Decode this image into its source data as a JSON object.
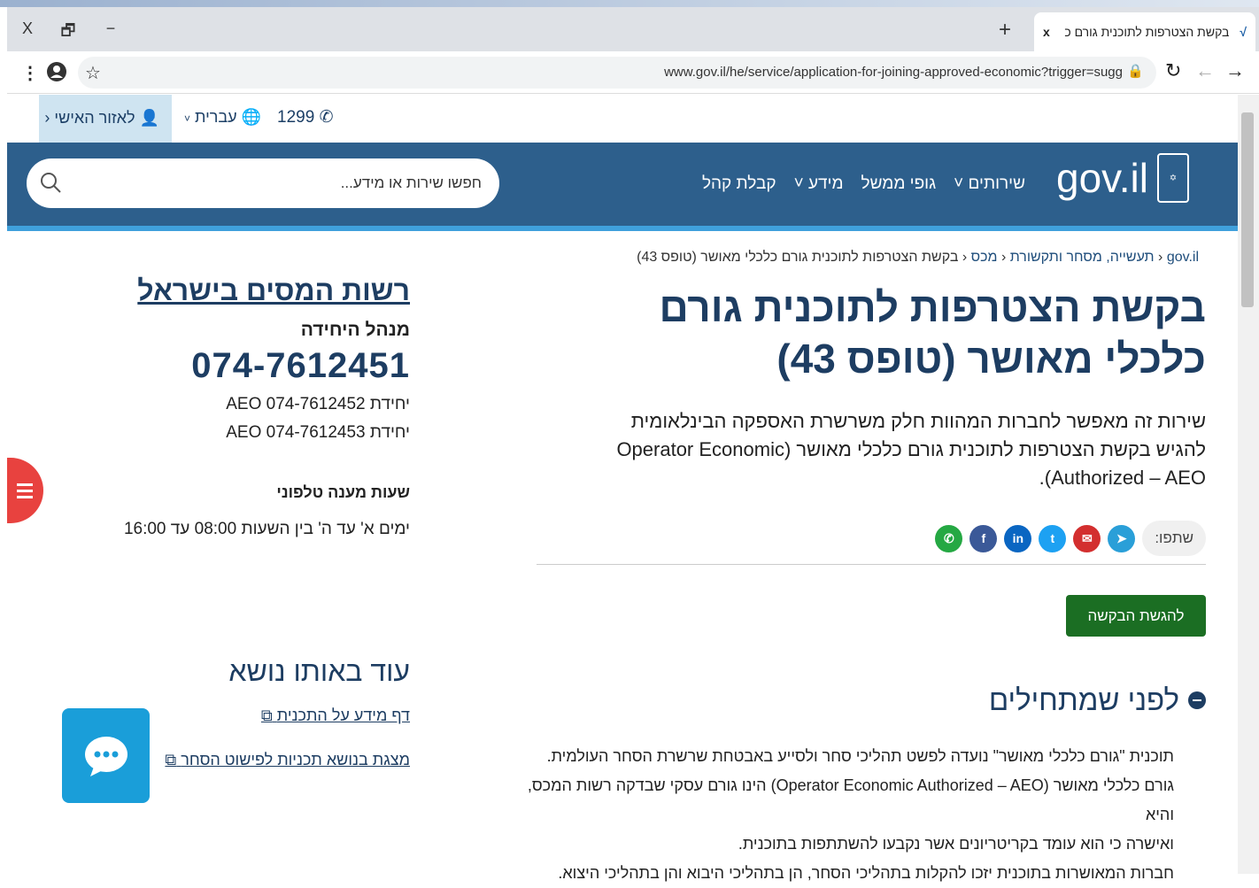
{
  "browser": {
    "tab_title": "בקשת הצטרפות לתוכנית גורם כ",
    "tab_close": "x",
    "url": "www.gov.il/he/service/application-for-joining-approved-economic?trigger=sugg",
    "close_label": "X",
    "restore_label": "🗗",
    "minimize_label": "−",
    "new_tab_label": "+"
  },
  "utility": {
    "personal_area": "לאזור האישי",
    "language": "עברית",
    "phone": "1299"
  },
  "header": {
    "logo_text": "gov.il",
    "nav": [
      "שירותים",
      "גופי ממשל",
      "מידע",
      "קבלת קהל"
    ],
    "search_placeholder": "חפשו שירות או מידע..."
  },
  "breadcrumb": [
    "gov.il",
    "תעשייה, מסחר ותקשורת",
    "מכס",
    "בקשת הצטרפות לתוכנית גורם כלכלי מאושר (טופס 43)"
  ],
  "page": {
    "title": "בקשת הצטרפות לתוכנית גורם כלכלי מאושר (טופס 43)",
    "description": "שירות זה מאפשר לחברות המהוות חלק משרשרת האספקה הבינלאומית להגיש בקשת הצטרפות לתוכנית גורם כלכלי מאושר (Operator Economic Authorized – AEO).",
    "share_label": "שתפו:",
    "submit_button": "להגשת הבקשה",
    "before_heading": "לפני שמתחילים",
    "body_lines": [
      "תוכנית \"גורם כלכלי מאושר\" נועדה לפשט תהליכי סחר ולסייע באבטחת שרשרת הסחר העולמית.",
      "גורם כלכלי מאושר (Operator Economic Authorized – AEO) הינו גורם עסקי שבדקה רשות המכס, והיא",
      "ואישרה כי הוא עומד בקריטריונים אשר נקבעו להשתתפות בתוכנית.",
      "חברות המאושרות בתוכנית יזכו להקלות בתהליכי הסחר, הן בתהליכי היבוא והן בתהליכי היצוא."
    ]
  },
  "sidebar": {
    "authority_link": "רשות המסים בישראל",
    "unit_manager": "מנהל היחידה",
    "main_phone": "074-7612451",
    "unit_phone_1": "יחידת AEO 074-7612452",
    "unit_phone_2": "יחידת AEO 074-7612453",
    "hours_title": "שעות מענה טלפוני",
    "hours_text": "ימים א' עד ה' בין השעות 08:00 עד 16:00",
    "more_heading": "עוד באותו נושא",
    "more_links": [
      "דף מידע על התכנית",
      "מצגת בנושא תכניות לפישוט הסחר"
    ]
  },
  "colors": {
    "header_bg": "#2d5f8c",
    "accent": "#3fa0dc",
    "submit_bg": "#1b6e23",
    "title_color": "#1d3d62"
  }
}
